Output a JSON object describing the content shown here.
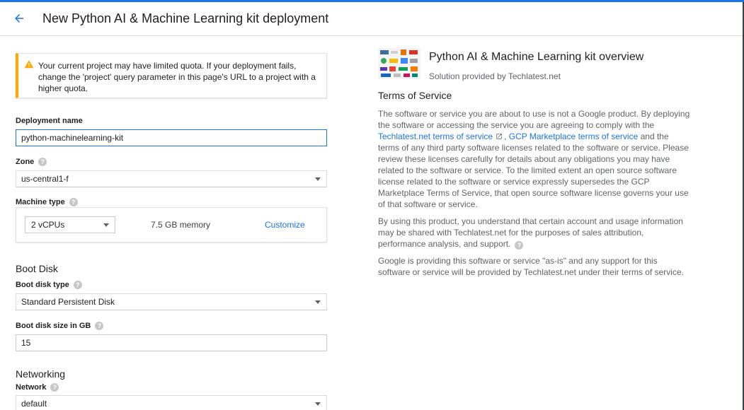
{
  "header": {
    "title": "New Python AI & Machine Learning kit deployment",
    "back_icon": "arrow-back-icon",
    "accent": "#1a73e8"
  },
  "warning": {
    "icon": "warning-icon",
    "color": "#f9ab00",
    "text": "Your current project may have limited quota. If your deployment fails, change the 'project' query parameter in this page's URL to a project with a higher quota."
  },
  "form": {
    "deployment_name": {
      "label": "Deployment name",
      "value": "python-machinelearning-kit"
    },
    "zone": {
      "label": "Zone",
      "value": "us-central1-f"
    },
    "machine_type": {
      "label": "Machine type",
      "vcpus": "2 vCPUs",
      "memory": "7.5 GB memory",
      "customize": "Customize"
    },
    "boot_disk": {
      "section_title": "Boot Disk",
      "type_label": "Boot disk type",
      "type_value": "Standard Persistent Disk",
      "size_label": "Boot disk size in GB",
      "size_value": "15"
    },
    "networking": {
      "section_title": "Networking",
      "network_label": "Network",
      "network_value": "default"
    }
  },
  "overview": {
    "title": "Python AI & Machine Learning kit overview",
    "provider": "Solution provided by Techlatest.net",
    "tos_title": "Terms of Service",
    "tos_p1_before": "The software or service you are about to use is not a Google product. By deploying the software or accessing the service you are agreeing to comply with the ",
    "tos_link1": "Techlatest.net terms of service",
    "tos_comma": ", ",
    "tos_link2": "GCP Marketplace terms of service",
    "tos_p1_after": " and the terms of any third party software licenses related to the software or service. Please review these licenses carefully for details about any obligations you may have related to the software or service. To the limited extent an open source software license related to the software or service expressly supersedes the GCP Marketplace Terms of Service, that open source software license governs your use of that software or service.",
    "tos_p2": "By using this product, you understand that certain account and usage information may be shared with Techlatest.net for the purposes of sales attribution, performance analysis, and support.",
    "tos_p3": "Google is providing this software or service \"as-is\" and any support for this software or service will be provided by Techlatest.net under their terms of service."
  }
}
